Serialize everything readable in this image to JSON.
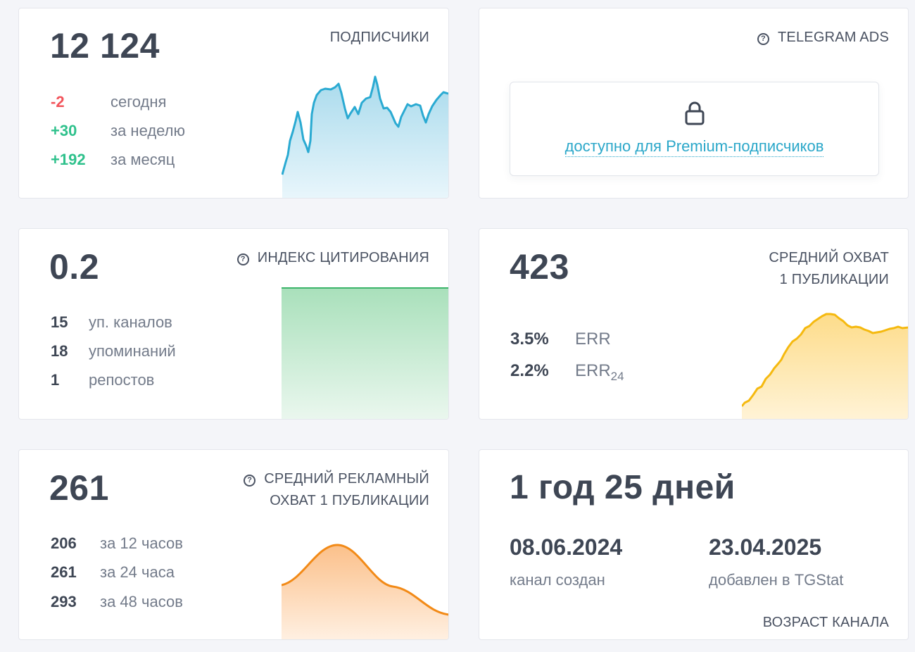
{
  "subscribers": {
    "value": "12 124",
    "title": "ПОДПИСЧИКИ",
    "stats": [
      {
        "value": "-2",
        "label": "сегодня",
        "kind": "neg"
      },
      {
        "value": "+30",
        "label": "за неделю",
        "kind": "pos"
      },
      {
        "value": "+192",
        "label": "за месяц",
        "kind": "pos"
      }
    ],
    "color": "#2aaad2"
  },
  "telegram_ads": {
    "title": "TELEGRAM ADS",
    "locked_text": "доступно для Premium-подписчиков",
    "icon": "lock-icon"
  },
  "citation": {
    "value": "0.2",
    "title": "ИНДЕКС ЦИТИРОВАНИЯ",
    "stats": [
      {
        "value": "15",
        "label": "уп. каналов"
      },
      {
        "value": "18",
        "label": "упоминаний"
      },
      {
        "value": "1",
        "label": "репостов"
      }
    ],
    "color": "#3cb46a"
  },
  "reach": {
    "value": "423",
    "title_line1": "СРЕДНИЙ ОХВАТ",
    "title_line2": "1 ПУБЛИКАЦИИ",
    "err": [
      {
        "value": "3.5%",
        "label": "ERR",
        "sub": ""
      },
      {
        "value": "2.2%",
        "label": "ERR",
        "sub": "24"
      }
    ],
    "color": "#f5b90f"
  },
  "ad_reach": {
    "value": "261",
    "title_line1": "СРЕДНИЙ РЕКЛАМНЫЙ",
    "title_line2": "ОХВАТ 1 ПУБЛИКАЦИИ",
    "stats": [
      {
        "value": "206",
        "label": "за 12 часов"
      },
      {
        "value": "261",
        "label": "за 24 часа"
      },
      {
        "value": "293",
        "label": "за 48 часов"
      }
    ],
    "color": "#f28a17"
  },
  "age": {
    "value": "1 год 25 дней",
    "created_date": "08.06.2024",
    "created_label": "канал создан",
    "added_date": "23.04.2025",
    "added_label": "добавлен в TGStat",
    "title": "ВОЗРАСТ КАНАЛА"
  }
}
